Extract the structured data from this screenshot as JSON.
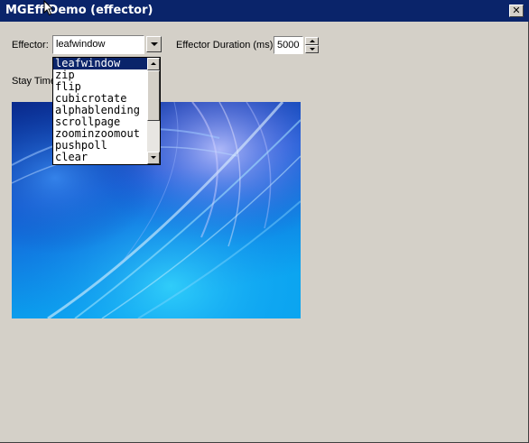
{
  "window": {
    "title": "MGEff Demo (effector)",
    "close_glyph": "✕"
  },
  "effector": {
    "label": "Effector:",
    "selected": "leafwindow",
    "options": [
      "leafwindow",
      "zip",
      "flip",
      "cubicrotate",
      "alphablending",
      "scrollpage",
      "zoominzoomout",
      "pushpoll",
      "clear"
    ]
  },
  "duration": {
    "label": "Effector Duration (ms):",
    "value": "5000"
  },
  "stay_time": {
    "label": "Stay Time"
  },
  "colors": {
    "titlebar": "#0a246a",
    "face": "#d4d0c8",
    "selection": "#0a246a"
  }
}
